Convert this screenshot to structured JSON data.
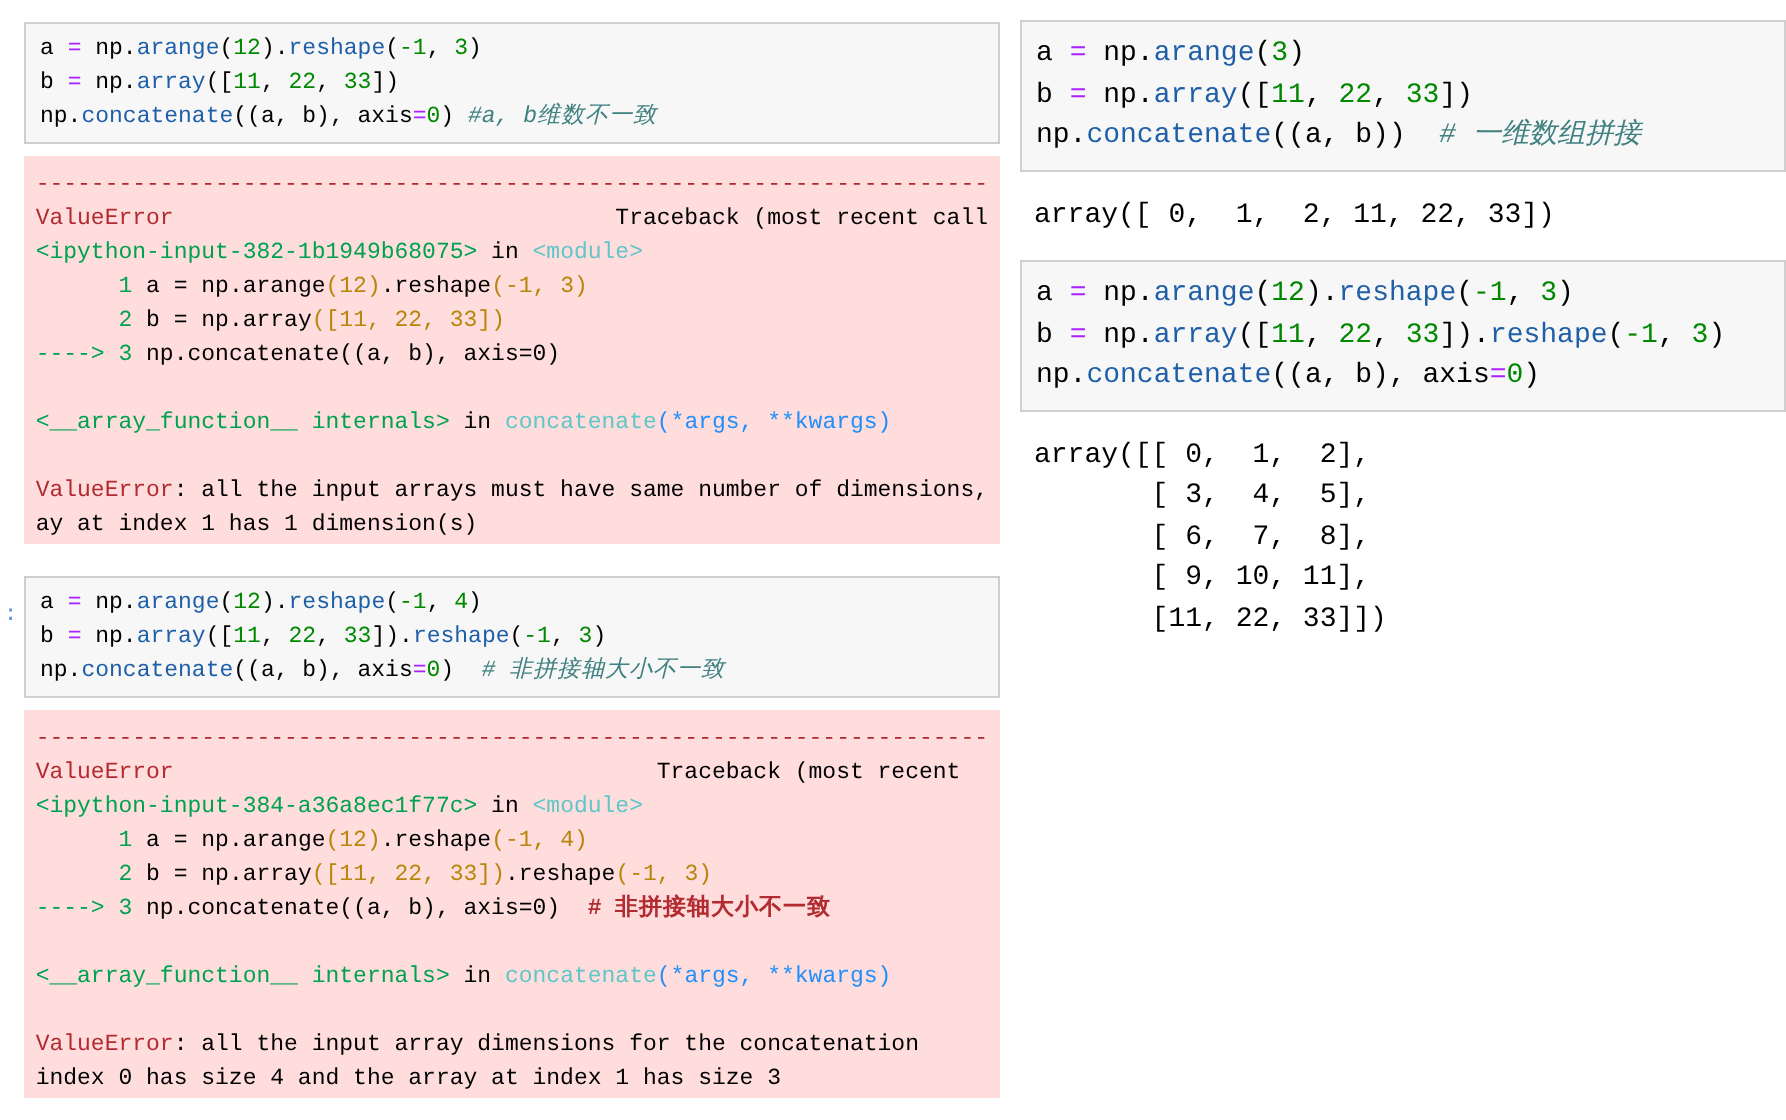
{
  "left_column": [
    {
      "kind": "input",
      "lines": [
        [
          {
            "text": "a ",
            "kind": "n"
          },
          {
            "text": "=",
            "kind": "o"
          },
          {
            "text": " np.",
            "kind": "n"
          },
          {
            "text": "arange",
            "kind": "f"
          },
          {
            "text": "(",
            "kind": "n"
          },
          {
            "text": "12",
            "kind": "d"
          },
          {
            "text": ").",
            "kind": "n"
          },
          {
            "text": "reshape",
            "kind": "f"
          },
          {
            "text": "(",
            "kind": "n"
          },
          {
            "text": "-1",
            "kind": "d"
          },
          {
            "text": ", ",
            "kind": "n"
          },
          {
            "text": "3",
            "kind": "d"
          },
          {
            "text": ")",
            "kind": "n"
          }
        ],
        [
          {
            "text": "b ",
            "kind": "n"
          },
          {
            "text": "=",
            "kind": "o"
          },
          {
            "text": " np.",
            "kind": "n"
          },
          {
            "text": "array",
            "kind": "f"
          },
          {
            "text": "([",
            "kind": "n"
          },
          {
            "text": "11",
            "kind": "d"
          },
          {
            "text": ", ",
            "kind": "n"
          },
          {
            "text": "22",
            "kind": "d"
          },
          {
            "text": ", ",
            "kind": "n"
          },
          {
            "text": "33",
            "kind": "d"
          },
          {
            "text": "])",
            "kind": "n"
          }
        ],
        [
          {
            "text": "np.",
            "kind": "n"
          },
          {
            "text": "concatenate",
            "kind": "f"
          },
          {
            "text": "((a, b), axis",
            "kind": "n"
          },
          {
            "text": "=",
            "kind": "o"
          },
          {
            "text": "0",
            "kind": "d"
          },
          {
            "text": ") ",
            "kind": "n"
          },
          {
            "text": "#a, b维数不一致",
            "kind": "c"
          }
        ]
      ]
    },
    {
      "kind": "error",
      "sections": [
        [
          [
            {
              "text": "---------------------------------------------------------------------",
              "kind": "red"
            }
          ],
          [
            {
              "text": "ValueError",
              "kind": "red"
            },
            {
              "text": "                                Traceback (most recent call",
              "kind": "n"
            }
          ],
          [
            {
              "text": "<ipython-input-382-1b1949b68075>",
              "kind": "grn"
            },
            {
              "text": " in ",
              "kind": "n"
            },
            {
              "text": "<module>",
              "kind": "cyn"
            }
          ],
          [
            {
              "text": "      1 ",
              "kind": "grn"
            },
            {
              "text": "a = np.arange",
              "kind": "n"
            },
            {
              "text": "(12)",
              "kind": "ylw"
            },
            {
              "text": ".reshape",
              "kind": "n"
            },
            {
              "text": "(-1, 3)",
              "kind": "ylw"
            }
          ],
          [
            {
              "text": "      2 ",
              "kind": "grn"
            },
            {
              "text": "b = np.array",
              "kind": "n"
            },
            {
              "text": "([11, 22, 33])",
              "kind": "ylw"
            }
          ],
          [
            {
              "text": "----> 3 ",
              "kind": "grn"
            },
            {
              "text": "np.concatenate((a, b), axis=0)",
              "kind": "n"
            }
          ]
        ],
        [
          [
            {
              "text": "<__array_function__ internals>",
              "kind": "grn"
            },
            {
              "text": " in ",
              "kind": "n"
            },
            {
              "text": "concatenate",
              "kind": "cyn"
            },
            {
              "text": "(*args, **kwargs)",
              "kind": "blu"
            }
          ]
        ],
        [
          [
            {
              "text": "ValueError",
              "kind": "red"
            },
            {
              "text": ": all the input arrays must have same number of dimensions,",
              "kind": "n"
            }
          ],
          [
            {
              "text": "ay at index 1 has 1 dimension(s)",
              "kind": "n"
            }
          ]
        ]
      ]
    },
    {
      "kind": "input",
      "prompt": ":",
      "lines": [
        [
          {
            "text": "a ",
            "kind": "n"
          },
          {
            "text": "=",
            "kind": "o"
          },
          {
            "text": " np.",
            "kind": "n"
          },
          {
            "text": "arange",
            "kind": "f"
          },
          {
            "text": "(",
            "kind": "n"
          },
          {
            "text": "12",
            "kind": "d"
          },
          {
            "text": ").",
            "kind": "n"
          },
          {
            "text": "reshape",
            "kind": "f"
          },
          {
            "text": "(",
            "kind": "n"
          },
          {
            "text": "-1",
            "kind": "d"
          },
          {
            "text": ", ",
            "kind": "n"
          },
          {
            "text": "4",
            "kind": "d"
          },
          {
            "text": ")",
            "kind": "n"
          }
        ],
        [
          {
            "text": "b ",
            "kind": "n"
          },
          {
            "text": "=",
            "kind": "o"
          },
          {
            "text": " np.",
            "kind": "n"
          },
          {
            "text": "array",
            "kind": "f"
          },
          {
            "text": "([",
            "kind": "n"
          },
          {
            "text": "11",
            "kind": "d"
          },
          {
            "text": ", ",
            "kind": "n"
          },
          {
            "text": "22",
            "kind": "d"
          },
          {
            "text": ", ",
            "kind": "n"
          },
          {
            "text": "33",
            "kind": "d"
          },
          {
            "text": "]).",
            "kind": "n"
          },
          {
            "text": "reshape",
            "kind": "f"
          },
          {
            "text": "(",
            "kind": "n"
          },
          {
            "text": "-1",
            "kind": "d"
          },
          {
            "text": ", ",
            "kind": "n"
          },
          {
            "text": "3",
            "kind": "d"
          },
          {
            "text": ")",
            "kind": "n"
          }
        ],
        [
          {
            "text": "np.",
            "kind": "n"
          },
          {
            "text": "concatenate",
            "kind": "f"
          },
          {
            "text": "((a, b), axis",
            "kind": "n"
          },
          {
            "text": "=",
            "kind": "o"
          },
          {
            "text": "0",
            "kind": "d"
          },
          {
            "text": ")  ",
            "kind": "n"
          },
          {
            "text": "# 非拼接轴大小不一致",
            "kind": "c"
          }
        ]
      ]
    },
    {
      "kind": "error",
      "sections": [
        [
          [
            {
              "text": "---------------------------------------------------------------------",
              "kind": "red"
            }
          ],
          [
            {
              "text": "ValueError",
              "kind": "red"
            },
            {
              "text": "                                   Traceback (most recent",
              "kind": "n"
            }
          ],
          [
            {
              "text": "<ipython-input-384-a36a8ec1f77c>",
              "kind": "grn"
            },
            {
              "text": " in ",
              "kind": "n"
            },
            {
              "text": "<module>",
              "kind": "cyn"
            }
          ],
          [
            {
              "text": "      1 ",
              "kind": "grn"
            },
            {
              "text": "a = np.arange",
              "kind": "n"
            },
            {
              "text": "(12)",
              "kind": "ylw"
            },
            {
              "text": ".reshape",
              "kind": "n"
            },
            {
              "text": "(-1, 4)",
              "kind": "ylw"
            }
          ],
          [
            {
              "text": "      2 ",
              "kind": "grn"
            },
            {
              "text": "b = np.array",
              "kind": "n"
            },
            {
              "text": "([11, 22, 33])",
              "kind": "ylw"
            },
            {
              "text": ".reshape",
              "kind": "n"
            },
            {
              "text": "(-1, 3)",
              "kind": "ylw"
            }
          ],
          [
            {
              "text": "----> 3 ",
              "kind": "grn"
            },
            {
              "text": "np.concatenate((a, b), axis=0)  ",
              "kind": "n"
            },
            {
              "text": "# 非拼接轴大小不一致",
              "kind": "redb"
            }
          ]
        ],
        [
          [
            {
              "text": "<__array_function__ internals>",
              "kind": "grn"
            },
            {
              "text": " in ",
              "kind": "n"
            },
            {
              "text": "concatenate",
              "kind": "cyn"
            },
            {
              "text": "(*args, **kwargs)",
              "kind": "blu"
            }
          ]
        ],
        [
          [
            {
              "text": "ValueError",
              "kind": "red"
            },
            {
              "text": ": all the input array dimensions for the concatenation",
              "kind": "n"
            }
          ],
          [
            {
              "text": "index 0 has size 4 and the array at index 1 has size 3",
              "kind": "n"
            }
          ]
        ]
      ]
    }
  ],
  "right_column": [
    {
      "kind": "input",
      "lines": [
        [
          {
            "text": "a ",
            "kind": "n"
          },
          {
            "text": "=",
            "kind": "o"
          },
          {
            "text": " np.",
            "kind": "n"
          },
          {
            "text": "arange",
            "kind": "f"
          },
          {
            "text": "(",
            "kind": "n"
          },
          {
            "text": "3",
            "kind": "d"
          },
          {
            "text": ")",
            "kind": "n"
          }
        ],
        [
          {
            "text": "b ",
            "kind": "n"
          },
          {
            "text": "=",
            "kind": "o"
          },
          {
            "text": " np.",
            "kind": "n"
          },
          {
            "text": "array",
            "kind": "f"
          },
          {
            "text": "([",
            "kind": "n"
          },
          {
            "text": "11",
            "kind": "d"
          },
          {
            "text": ", ",
            "kind": "n"
          },
          {
            "text": "22",
            "kind": "d"
          },
          {
            "text": ", ",
            "kind": "n"
          },
          {
            "text": "33",
            "kind": "d"
          },
          {
            "text": "])",
            "kind": "n"
          }
        ],
        [
          {
            "text": "np.",
            "kind": "n"
          },
          {
            "text": "concatenate",
            "kind": "f"
          },
          {
            "text": "((a, b))  ",
            "kind": "n"
          },
          {
            "text": "# 一维数组拼接",
            "kind": "c"
          }
        ]
      ]
    },
    {
      "kind": "output",
      "lines": [
        "array([ 0,  1,  2, 11, 22, 33])"
      ]
    },
    {
      "kind": "input",
      "lines": [
        [
          {
            "text": "a ",
            "kind": "n"
          },
          {
            "text": "=",
            "kind": "o"
          },
          {
            "text": " np.",
            "kind": "n"
          },
          {
            "text": "arange",
            "kind": "f"
          },
          {
            "text": "(",
            "kind": "n"
          },
          {
            "text": "12",
            "kind": "d"
          },
          {
            "text": ").",
            "kind": "n"
          },
          {
            "text": "reshape",
            "kind": "f"
          },
          {
            "text": "(",
            "kind": "n"
          },
          {
            "text": "-1",
            "kind": "d"
          },
          {
            "text": ", ",
            "kind": "n"
          },
          {
            "text": "3",
            "kind": "d"
          },
          {
            "text": ")",
            "kind": "n"
          }
        ],
        [
          {
            "text": "b ",
            "kind": "n"
          },
          {
            "text": "=",
            "kind": "o"
          },
          {
            "text": " np.",
            "kind": "n"
          },
          {
            "text": "array",
            "kind": "f"
          },
          {
            "text": "([",
            "kind": "n"
          },
          {
            "text": "11",
            "kind": "d"
          },
          {
            "text": ", ",
            "kind": "n"
          },
          {
            "text": "22",
            "kind": "d"
          },
          {
            "text": ", ",
            "kind": "n"
          },
          {
            "text": "33",
            "kind": "d"
          },
          {
            "text": "]).",
            "kind": "n"
          },
          {
            "text": "reshape",
            "kind": "f"
          },
          {
            "text": "(",
            "kind": "n"
          },
          {
            "text": "-1",
            "kind": "d"
          },
          {
            "text": ", ",
            "kind": "n"
          },
          {
            "text": "3",
            "kind": "d"
          },
          {
            "text": ")",
            "kind": "n"
          }
        ],
        [
          {
            "text": "np.",
            "kind": "n"
          },
          {
            "text": "concatenate",
            "kind": "f"
          },
          {
            "text": "((a, b), axis",
            "kind": "n"
          },
          {
            "text": "=",
            "kind": "o"
          },
          {
            "text": "0",
            "kind": "d"
          },
          {
            "text": ")",
            "kind": "n"
          }
        ]
      ]
    },
    {
      "kind": "output",
      "lines": [
        "array([[ 0,  1,  2],",
        "       [ 3,  4,  5],",
        "       [ 6,  7,  8],",
        "       [ 9, 10, 11],",
        "       [11, 22, 33]])"
      ]
    }
  ]
}
